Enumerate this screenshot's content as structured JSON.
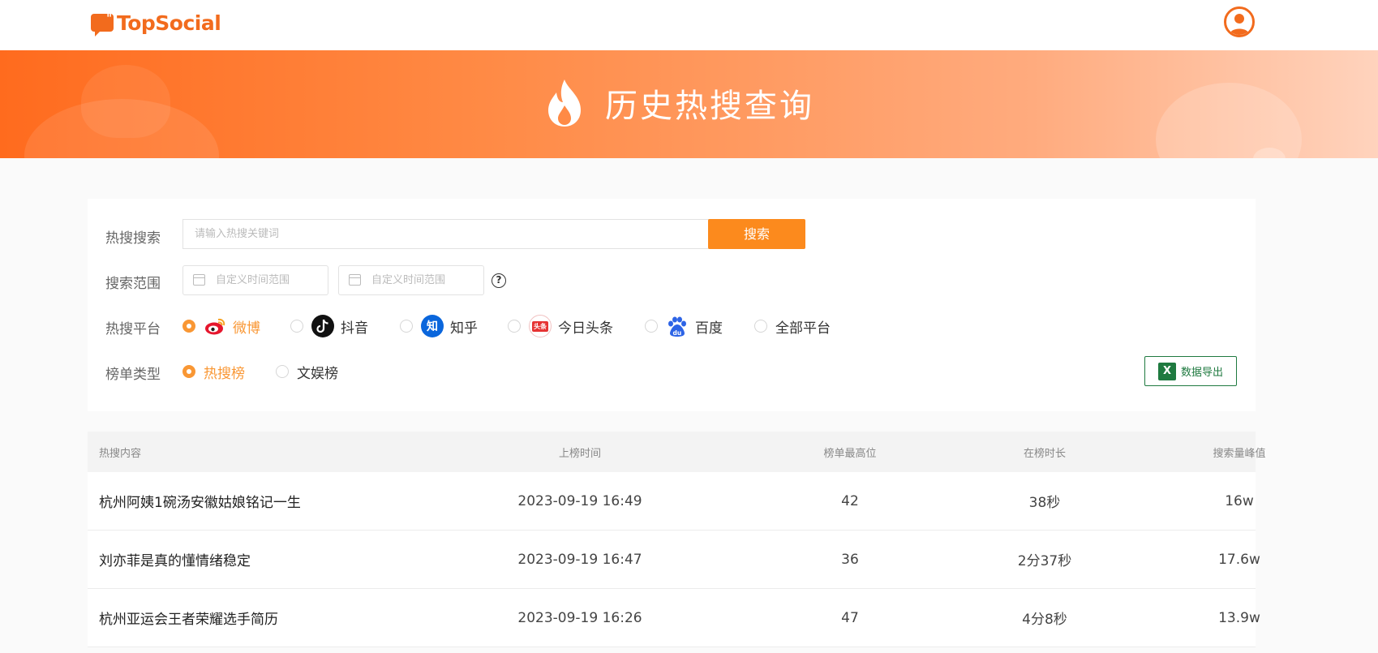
{
  "header": {
    "logo_text": "TopSocial",
    "avatar_icon": "user-avatar-icon"
  },
  "banner": {
    "title": "历史热搜查询",
    "icon": "flame-icon"
  },
  "filters": {
    "search_label": "热搜搜索",
    "search_placeholder": "请输入热搜关键词",
    "search_button": "搜索",
    "range_label": "搜索范围",
    "date_start_placeholder": "自定义时间范围",
    "date_end_placeholder": "自定义时间范围",
    "help_icon": "?",
    "platform_label": "热搜平台",
    "platforms": [
      {
        "label": "微博",
        "selected": true,
        "icon": "weibo-icon",
        "color": "#e6162d"
      },
      {
        "label": "抖音",
        "selected": false,
        "icon": "douyin-icon",
        "color": "#111111"
      },
      {
        "label": "知乎",
        "selected": false,
        "icon": "zhihu-icon",
        "color": "#0a66dc",
        "glyph": "知"
      },
      {
        "label": "今日头条",
        "selected": false,
        "icon": "toutiao-icon",
        "color": "#e63333",
        "glyph": "头条"
      },
      {
        "label": "百度",
        "selected": false,
        "icon": "baidu-icon",
        "color": "#2d64e6",
        "glyph": "du"
      },
      {
        "label": "全部平台",
        "selected": false,
        "icon": "",
        "color": ""
      }
    ],
    "list_type_label": "榜单类型",
    "list_types": [
      {
        "label": "热搜榜",
        "selected": true
      },
      {
        "label": "文娱榜",
        "selected": false
      }
    ],
    "export_button": "数据导出",
    "export_icon": "X"
  },
  "table": {
    "columns": [
      "热搜内容",
      "上榜时间",
      "榜单最高位",
      "在榜时长",
      "搜索量峰值"
    ],
    "rows": [
      [
        "杭州阿姨1碗汤安徽姑娘铭记一生",
        "2023-09-19 16:49",
        "42",
        "38秒",
        "16w"
      ],
      [
        "刘亦菲是真的懂情绪稳定",
        "2023-09-19 16:47",
        "36",
        "2分37秒",
        "17.6w"
      ],
      [
        "杭州亚运会王者荣耀选手简历",
        "2023-09-19 16:26",
        "47",
        "4分8秒",
        "13.9w"
      ]
    ]
  },
  "colors": {
    "brand": "#f26b1d",
    "accent": "#fc8a1d",
    "export_green": "#1f7a40"
  }
}
